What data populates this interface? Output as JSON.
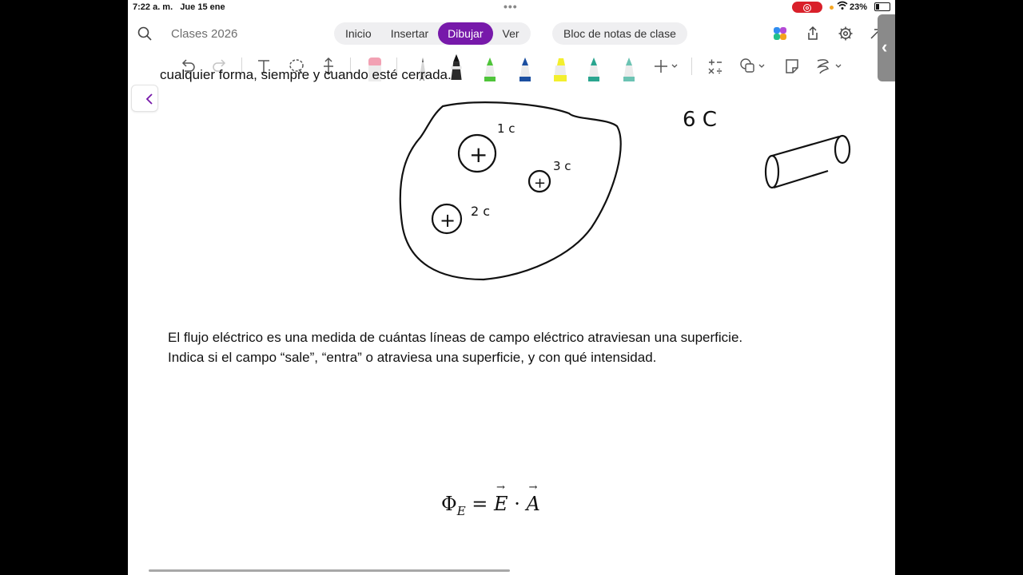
{
  "status_bar": {
    "time": "7:22 a. m.",
    "date": "Jue 15 ene",
    "battery": "23%",
    "record_color": "#d9202a"
  },
  "nav": {
    "notebook_title": "Clases 2026",
    "tabs": [
      {
        "label": "Inicio",
        "active": false
      },
      {
        "label": "Insertar",
        "active": false
      },
      {
        "label": "Dibujar",
        "active": true
      },
      {
        "label": "Ver",
        "active": false
      }
    ],
    "class_notebook": "Bloc de notas de clase",
    "accent_color": "#7719aa",
    "icons": [
      "search-icon",
      "copilot-icon",
      "share-icon",
      "settings-icon",
      "expand-icon"
    ]
  },
  "toolbar": {
    "tools": [
      "undo-icon",
      "redo-icon",
      "type-text-icon",
      "lasso-select-icon",
      "add-space-icon",
      "eraser-icon",
      "pencil-icon",
      "black-pen-icon",
      "green-pen-icon",
      "blue-pen-icon",
      "yellow-highlighter-icon",
      "teal-pen-icon",
      "light-teal-pen-icon",
      "add-pen-icon",
      "ink-to-math-icon",
      "shapes-icon",
      "ink-to-text-icon",
      "replay-icon"
    ]
  },
  "page": {
    "clipped_line": "cualquier forma, siempre y cuando esté cerrada.",
    "paragraph": [
      "El flujo eléctrico es una medida de cuántas líneas de campo eléctrico atraviesan una superficie.",
      "Indica si el campo “sale”, “entra” o atraviesa una superficie, y con qué intensidad."
    ],
    "formula": {
      "symbol": "Φ",
      "subscript": "E",
      "equals": "=",
      "field": "E",
      "dot": "·",
      "area": "A"
    }
  },
  "ink": {
    "labels": [
      "1 c",
      "3 c",
      "2 c",
      "6 C"
    ],
    "charge_symbol": "+"
  }
}
